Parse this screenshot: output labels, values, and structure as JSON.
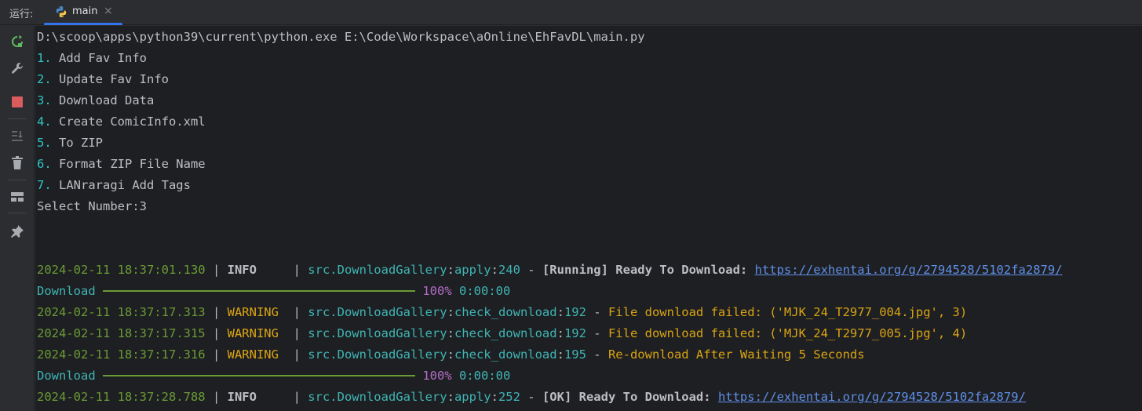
{
  "tabbar": {
    "run_label": "运行:",
    "tab_label": "main",
    "close_glyph": "×"
  },
  "sidebar": {
    "tools": [
      "rerun-icon",
      "wrench-icon",
      "stop-icon",
      "scroll-to-end-icon",
      "trash-icon",
      "layout-icon",
      "pin-icon"
    ]
  },
  "console": {
    "cmd": "D:\\scoop\\apps\\python39\\current\\python.exe E:\\Code\\Workspace\\aOnline\\EhFavDL\\main.py",
    "menu": [
      {
        "num": "1.",
        "text": " Add Fav Info"
      },
      {
        "num": "2.",
        "text": " Update Fav Info"
      },
      {
        "num": "3.",
        "text": " Download Data"
      },
      {
        "num": "4.",
        "text": " Create ComicInfo.xml"
      },
      {
        "num": "5.",
        "text": " To ZIP"
      },
      {
        "num": "6.",
        "text": " Format ZIP File Name"
      },
      {
        "num": "7.",
        "text": " LANraragi Add Tags"
      }
    ],
    "prompt": "Select Number:3",
    "logs": [
      {
        "kind": "log",
        "ts": "2024-02-11 18:37:01.130",
        "level": "INFO    ",
        "module": "src.DownloadGallery",
        "func": "apply",
        "lineno": "240",
        "msg": "[Running] Ready To Download: ",
        "link": "https://exhentai.org/g/2794528/5102fa2879/",
        "style": "info"
      },
      {
        "kind": "progress",
        "label": "Download",
        "percent": "100%",
        "time": "0:00:00"
      },
      {
        "kind": "log",
        "ts": "2024-02-11 18:37:17.313",
        "level": "WARNING ",
        "module": "src.DownloadGallery",
        "func": "check_download",
        "lineno": "192",
        "msg": "File download failed: ('MJK_24_T2977_004.jpg', 3)",
        "link": "",
        "style": "warn"
      },
      {
        "kind": "log",
        "ts": "2024-02-11 18:37:17.315",
        "level": "WARNING ",
        "module": "src.DownloadGallery",
        "func": "check_download",
        "lineno": "192",
        "msg": "File download failed: ('MJK_24_T2977_005.jpg', 4)",
        "link": "",
        "style": "warn"
      },
      {
        "kind": "log",
        "ts": "2024-02-11 18:37:17.316",
        "level": "WARNING ",
        "module": "src.DownloadGallery",
        "func": "check_download",
        "lineno": "195",
        "msg": "Re-download After Waiting 5 Seconds",
        "link": "",
        "style": "warn"
      },
      {
        "kind": "progress",
        "label": "Download",
        "percent": "100%",
        "time": "0:00:00"
      },
      {
        "kind": "log",
        "ts": "2024-02-11 18:37:28.788",
        "level": "INFO    ",
        "module": "src.DownloadGallery",
        "func": "apply",
        "lineno": "252",
        "msg": "[OK] Ready To Download: ",
        "link": "https://exhentai.org/g/2794528/5102fa2879/",
        "style": "info"
      }
    ]
  }
}
